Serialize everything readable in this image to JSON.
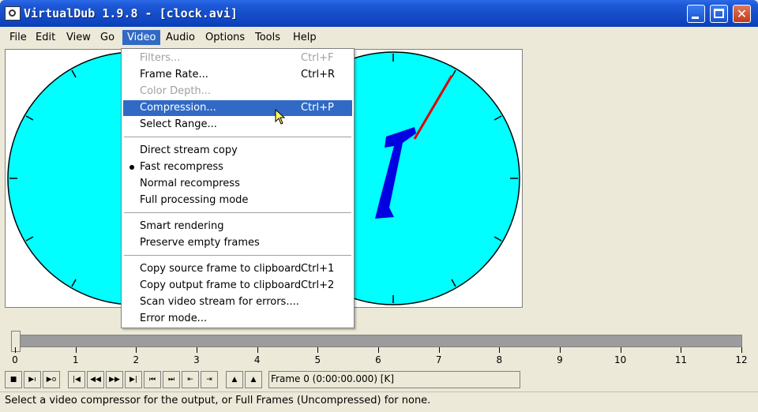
{
  "window": {
    "title": "VirtualDub 1.9.8 - [clock.avi]"
  },
  "menubar": {
    "items": [
      "File",
      "Edit",
      "View",
      "Go",
      "Video",
      "Audio",
      "Options",
      "Tools",
      "Help"
    ],
    "active": "Video"
  },
  "video_menu": {
    "items": [
      {
        "label": "Filters...",
        "shortcut": "Ctrl+F",
        "disabled": true
      },
      {
        "label": "Frame Rate...",
        "shortcut": "Ctrl+R"
      },
      {
        "label": "Color Depth...",
        "disabled": true
      },
      {
        "label": "Compression...",
        "shortcut": "Ctrl+P",
        "highlighted": true
      },
      {
        "label": "Select Range..."
      },
      {
        "label": "Direct stream copy"
      },
      {
        "label": "Fast recompress",
        "selected": true
      },
      {
        "label": "Normal recompress"
      },
      {
        "label": "Full processing mode"
      },
      {
        "label": "Smart rendering"
      },
      {
        "label": "Preserve empty frames"
      },
      {
        "label": "Copy source frame to clipboard",
        "shortcut": "Ctrl+1"
      },
      {
        "label": "Copy output frame to clipboard",
        "shortcut": "Ctrl+2"
      },
      {
        "label": "Scan video stream for errors...."
      },
      {
        "label": "Error mode..."
      }
    ]
  },
  "timeline": {
    "ticks": [
      "0",
      "1",
      "2",
      "3",
      "4",
      "5",
      "6",
      "7",
      "8",
      "9",
      "10",
      "11",
      "12"
    ],
    "position": 0
  },
  "frame_info": "Frame 0 (0:00:00.000) [K]",
  "status": "Select a video compressor for the output, or Full Frames (Uncompressed) for none.",
  "colors": {
    "clock_face": "#00ffff",
    "numeral": "#0000e0",
    "hand": "#e00000",
    "menu_highlight": "#316ac5",
    "titlebar": "#0a3fb8"
  },
  "icons": [
    "app-icon",
    "minimize-icon",
    "maximize-icon",
    "close-icon",
    "mouse-cursor-icon"
  ]
}
